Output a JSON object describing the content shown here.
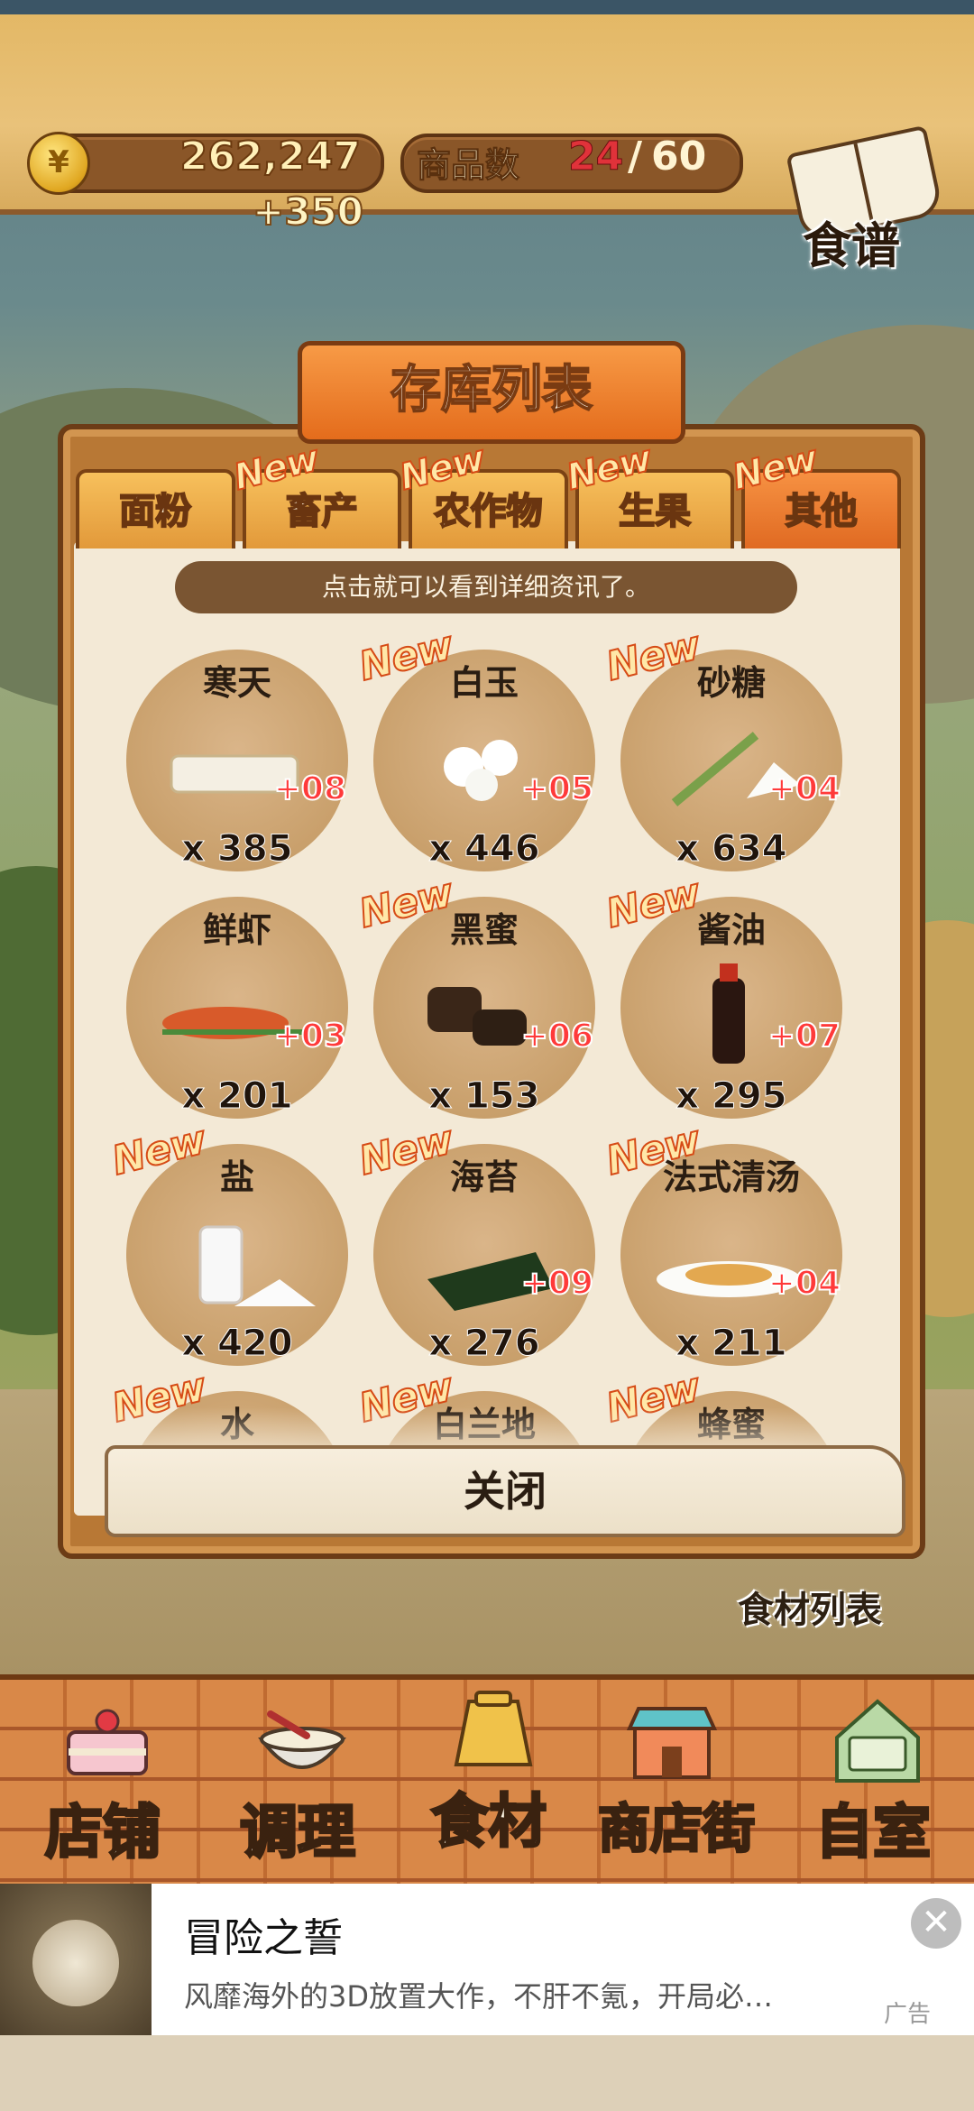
{
  "hud": {
    "currency_symbol": "¥",
    "money": "262,247",
    "gain": "+350",
    "goods_label": "商品数",
    "goods_current": "24",
    "goods_slash": "/",
    "goods_max": "60",
    "recipe_label": "食谱"
  },
  "panel": {
    "title": "存库列表",
    "tabs": [
      {
        "label": "面粉",
        "new": ""
      },
      {
        "label": "畜产",
        "new": "New"
      },
      {
        "label": "农作物",
        "new": "New"
      },
      {
        "label": "生果",
        "new": "New"
      },
      {
        "label": "其他",
        "new": "New"
      }
    ],
    "hint": "点击就可以看到详细资讯了。",
    "items": [
      {
        "name": "寒天",
        "new": "",
        "bonus": "+08",
        "count": "x 385"
      },
      {
        "name": "白玉",
        "new": "New",
        "bonus": "+05",
        "count": "x 446"
      },
      {
        "name": "砂糖",
        "new": "New",
        "bonus": "+04",
        "count": "x 634"
      },
      {
        "name": "鲜虾",
        "new": "",
        "bonus": "+03",
        "count": "x 201"
      },
      {
        "name": "黑蜜",
        "new": "New",
        "bonus": "+06",
        "count": "x 153"
      },
      {
        "name": "酱油",
        "new": "New",
        "bonus": "+07",
        "count": "x 295"
      },
      {
        "name": "盐",
        "new": "New",
        "bonus": "",
        "count": "x 420"
      },
      {
        "name": "海苔",
        "new": "New",
        "bonus": "+09",
        "count": "x 276"
      },
      {
        "name": "法式清汤",
        "new": "New",
        "bonus": "+04",
        "count": "x 211"
      },
      {
        "name": "水",
        "new": "New",
        "bonus": "",
        "count": ""
      },
      {
        "name": "白兰地",
        "new": "New",
        "bonus": "",
        "count": ""
      },
      {
        "name": "蜂蜜",
        "new": "New",
        "bonus": "",
        "count": ""
      }
    ],
    "close_label": "关闭",
    "footer_label": "食材列表"
  },
  "nav": [
    {
      "label": "店铺",
      "icon": "cake-icon"
    },
    {
      "label": "调理",
      "icon": "mixing-bowl-icon"
    },
    {
      "label": "食材",
      "icon": "flour-sack-icon"
    },
    {
      "label": "商店街",
      "icon": "shop-icon"
    },
    {
      "label": "自室",
      "icon": "staff-only-sign-icon"
    }
  ],
  "ad": {
    "title": "冒险之誓",
    "desc": "风靡海外的3D放置大作，不肝不氪，开局必…",
    "tag": "广告",
    "close": "✕"
  },
  "colors": {
    "accent": "#e46c1c",
    "bonus": "#ff3a3a",
    "goods_current": "#e0323a",
    "panel_paper": "#f3e9d6"
  }
}
